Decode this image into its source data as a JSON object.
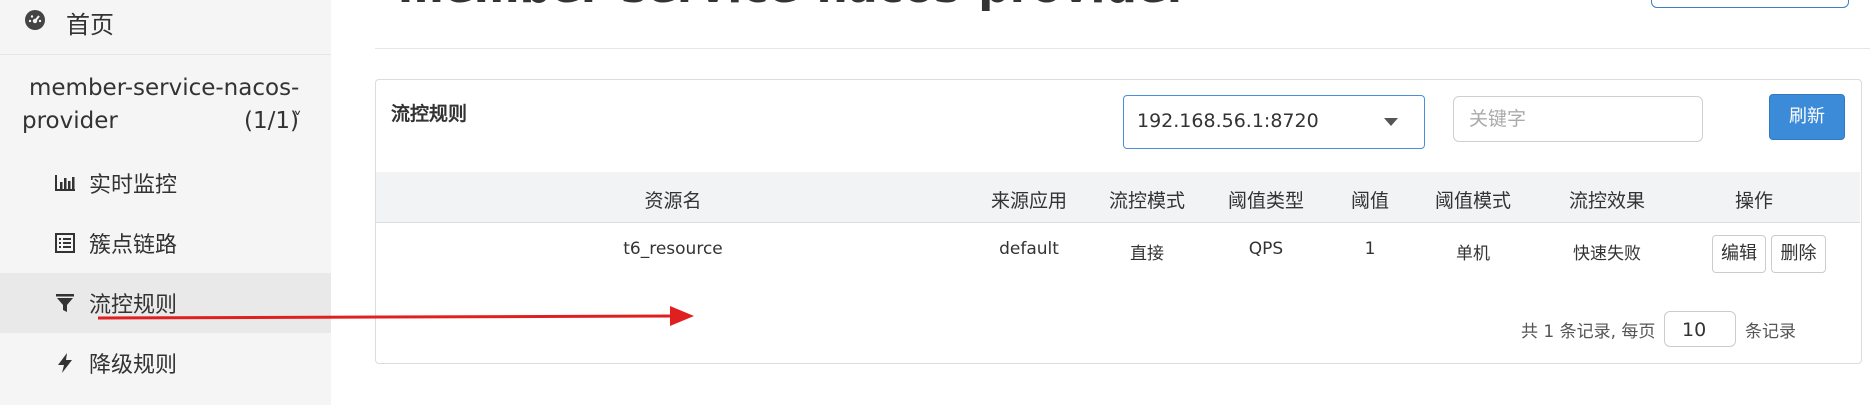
{
  "sidebar": {
    "home_label": "首页",
    "app": {
      "name_line1": "member-service-nacos-",
      "name_line2": "provider",
      "count": "(1/1)",
      "chevron": "˅"
    },
    "items": [
      {
        "label": "实时监控",
        "icon": "bar-chart-icon"
      },
      {
        "label": "簇点链路",
        "icon": "list-icon"
      },
      {
        "label": "流控规则",
        "icon": "filter-icon",
        "active": true
      },
      {
        "label": "降级规则",
        "icon": "bolt-icon"
      }
    ]
  },
  "header": {
    "title": "member-service-nacos-provider"
  },
  "panel": {
    "title": "流控规则",
    "machine_select": {
      "value": "192.168.56.1:8720"
    },
    "search": {
      "placeholder": "关键字"
    },
    "refresh_label": "刷新"
  },
  "table": {
    "headers": [
      "资源名",
      "来源应用",
      "流控模式",
      "阈值类型",
      "阈值",
      "阈值模式",
      "流控效果",
      "操作"
    ],
    "rows": [
      {
        "resource": "t6_resource",
        "limit_app": "default",
        "strategy": "直接",
        "grade": "QPS",
        "count": "1",
        "cluster_mode": "单机",
        "control_behavior": "快速失败",
        "edit_label": "编辑",
        "delete_label": "删除"
      }
    ]
  },
  "pagination": {
    "prefix": "共 1 条记录, 每页",
    "page_size": "10",
    "suffix": "条记录"
  },
  "colors": {
    "accent": "#3c8bd9",
    "annotation_arrow": "#e02020",
    "sidebar_bg": "#f5f5f5"
  }
}
